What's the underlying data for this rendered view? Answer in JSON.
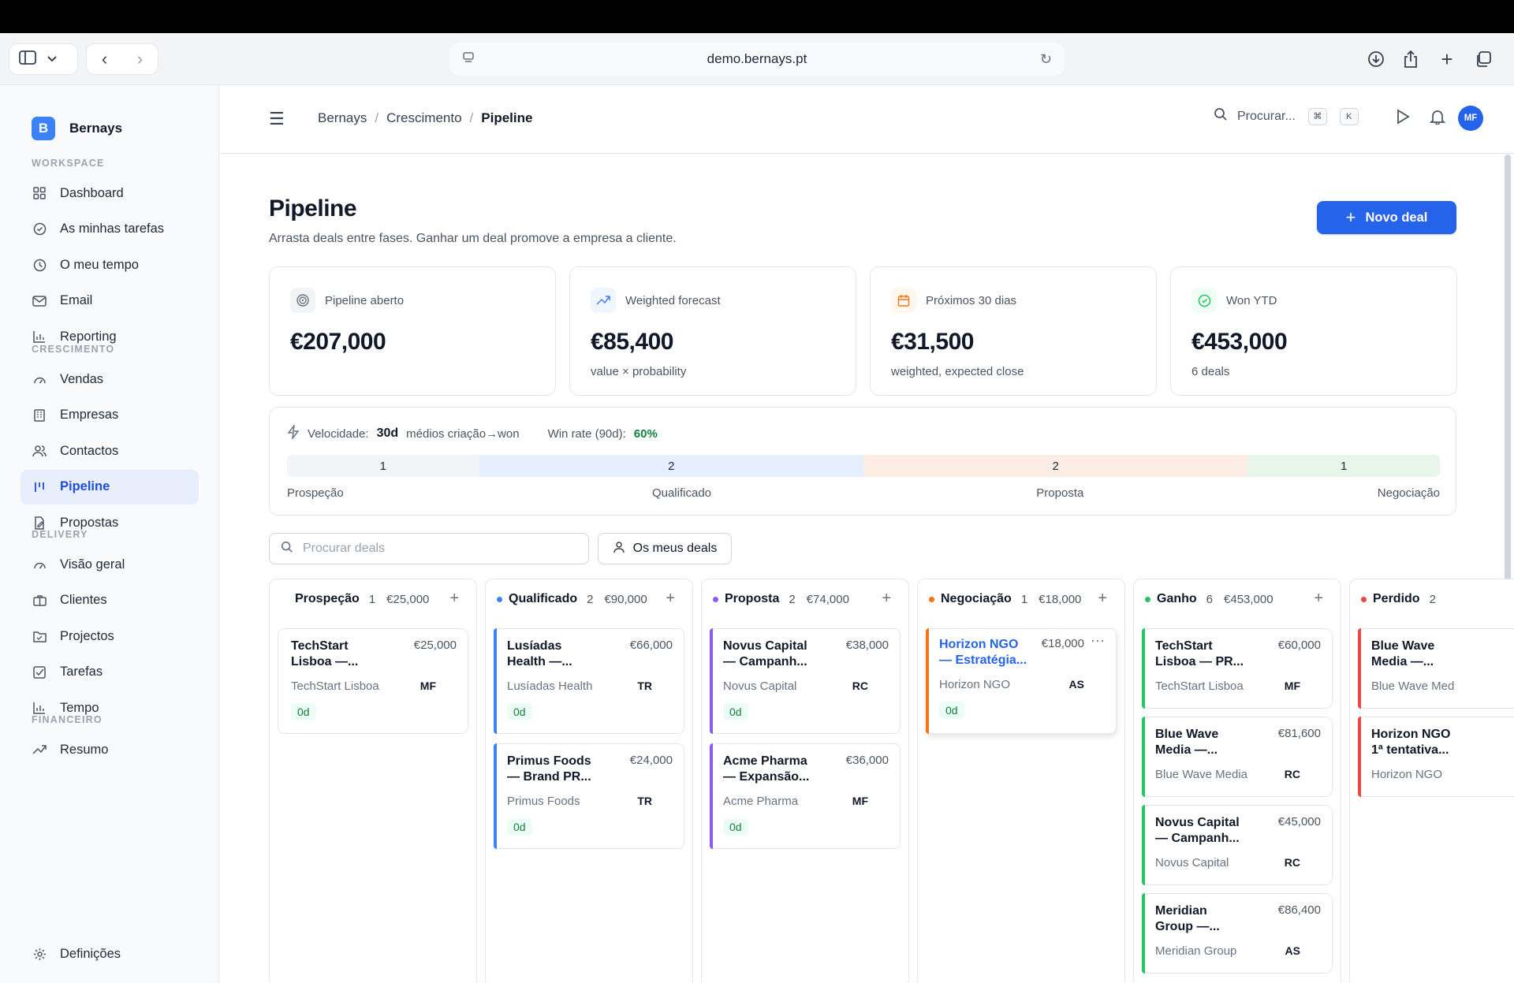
{
  "browser": {
    "url": "demo.bernays.pt"
  },
  "sidebar": {
    "brand": {
      "logo_letter": "B",
      "name": "Bernays"
    },
    "sections": [
      {
        "title": "WORKSPACE",
        "items": [
          {
            "label": "Dashboard",
            "icon": "grid-icon"
          },
          {
            "label": "As minhas tarefas",
            "icon": "check-circle-icon"
          },
          {
            "label": "O meu tempo",
            "icon": "clock-icon"
          },
          {
            "label": "Email",
            "icon": "mail-icon"
          },
          {
            "label": "Reporting",
            "icon": "bar-chart-icon"
          }
        ]
      },
      {
        "title": "CRESCIMENTO",
        "items": [
          {
            "label": "Vendas",
            "icon": "gauge-icon"
          },
          {
            "label": "Empresas",
            "icon": "building-icon"
          },
          {
            "label": "Contactos",
            "icon": "users-icon"
          },
          {
            "label": "Pipeline",
            "icon": "pipeline-icon",
            "active": true
          },
          {
            "label": "Propostas",
            "icon": "file-edit-icon"
          }
        ]
      },
      {
        "title": "DELIVERY",
        "items": [
          {
            "label": "Visão geral",
            "icon": "gauge-icon"
          },
          {
            "label": "Clientes",
            "icon": "briefcase-icon"
          },
          {
            "label": "Projectos",
            "icon": "folder-icon"
          },
          {
            "label": "Tarefas",
            "icon": "checkbox-icon"
          },
          {
            "label": "Tempo",
            "icon": "bar-chart-icon"
          }
        ]
      },
      {
        "title": "FINANCEIRO",
        "items": [
          {
            "label": "Resumo",
            "icon": "trend-up-icon"
          }
        ]
      }
    ],
    "settings_label": "Definições"
  },
  "header": {
    "breadcrumbs": [
      "Bernays",
      "Crescimento",
      "Pipeline"
    ],
    "search_label": "Procurar...",
    "kbd_1": "⌘",
    "kbd_2": "K",
    "avatar_initials": "MF"
  },
  "page": {
    "title": "Pipeline",
    "subtitle": "Arrasta deals entre fases. Ganhar um deal promove a empresa a cliente.",
    "new_deal_label": "Novo deal"
  },
  "kpis": [
    {
      "label": "Pipeline aberto",
      "value": "€207,000",
      "note": "",
      "icon": "target-icon",
      "color": "#6b7280",
      "bg": "#f3f4f6"
    },
    {
      "label": "Weighted forecast",
      "value": "€85,400",
      "note": "value × probability",
      "icon": "trend-up-icon",
      "color": "#3b82f6",
      "bg": "#eff6ff"
    },
    {
      "label": "Próximos 30 dias",
      "value": "€31,500",
      "note": "weighted, expected close",
      "icon": "calendar-icon",
      "color": "#f97316",
      "bg": "#fff7ed"
    },
    {
      "label": "Won YTD",
      "value": "€453,000",
      "note": "6 deals",
      "icon": "check-circle-icon",
      "color": "#22c55e",
      "bg": "#f0fdf4"
    }
  ],
  "velocity": {
    "label": "Velocidade:",
    "value": "30d",
    "desc": "médios criação→won",
    "winrate_label": "Win rate (90d):",
    "winrate_value": "60%",
    "stages": [
      {
        "label": "Prospeção",
        "count": "1",
        "color": "#f3f4f6"
      },
      {
        "label": "Qualificado",
        "count": "2",
        "color": "#e6efff"
      },
      {
        "label": "Proposta",
        "count": "2",
        "color": "#fbede4"
      },
      {
        "label": "Negociação",
        "count": "1",
        "color": "#e8f5e9"
      }
    ]
  },
  "filters": {
    "search_placeholder": "Procurar deals",
    "my_deals_label": "Os meus deals"
  },
  "columns": [
    {
      "name": "Prospeção",
      "count": "1",
      "total": "€25,000",
      "dot": "",
      "bar": "",
      "cards": [
        {
          "title": "TechStart Lisboa —...",
          "amount": "€25,000",
          "company": "TechStart Lisboa",
          "initials": "MF",
          "age": "0d"
        }
      ]
    },
    {
      "name": "Qualificado",
      "count": "2",
      "total": "€90,000",
      "dot": "#3b82f6",
      "bar": "#3b82f6",
      "cards": [
        {
          "title": "Lusíadas Health —...",
          "amount": "€66,000",
          "company": "Lusíadas Health",
          "initials": "TR",
          "age": "0d"
        },
        {
          "title": "Primus Foods — Brand PR...",
          "amount": "€24,000",
          "company": "Primus Foods",
          "initials": "TR",
          "age": "0d"
        }
      ]
    },
    {
      "name": "Proposta",
      "count": "2",
      "total": "€74,000",
      "dot": "#8b5cf6",
      "bar": "#8b5cf6",
      "cards": [
        {
          "title": "Novus Capital — Campanh...",
          "amount": "€38,000",
          "company": "Novus Capital",
          "initials": "RC",
          "age": "0d"
        },
        {
          "title": "Acme Pharma — Expansão...",
          "amount": "€36,000",
          "company": "Acme Pharma",
          "initials": "MF",
          "age": "0d"
        }
      ]
    },
    {
      "name": "Negociação",
      "count": "1",
      "total": "€18,000",
      "dot": "#f97316",
      "bar": "#f97316",
      "cards": [
        {
          "title": "Horizon NGO — Estratégia...",
          "amount": "€18,000",
          "company": "Horizon NGO",
          "initials": "AS",
          "age": "0d",
          "link": true,
          "more": "···"
        }
      ]
    },
    {
      "name": "Ganho",
      "count": "6",
      "total": "€453,000",
      "dot": "#22c55e",
      "bar": "#22c55e",
      "cards": [
        {
          "title": "TechStart Lisboa — PR...",
          "amount": "€60,000",
          "company": "TechStart Lisboa",
          "initials": "MF"
        },
        {
          "title": "Blue Wave Media —...",
          "amount": "€81,600",
          "company": "Blue Wave Media",
          "initials": "RC"
        },
        {
          "title": "Novus Capital — Campanh...",
          "amount": "€45,000",
          "company": "Novus Capital",
          "initials": "RC"
        },
        {
          "title": "Meridian Group —...",
          "amount": "€86,400",
          "company": "Meridian Group",
          "initials": "AS"
        }
      ]
    },
    {
      "name": "Perdido",
      "count": "2",
      "total": "",
      "dot": "#ef4444",
      "bar": "#ef4444",
      "cards": [
        {
          "title": "Blue Wave Media —...",
          "amount": "",
          "company": "Blue Wave Med",
          "initials": ""
        },
        {
          "title": "Horizon NGO 1ª tentativa...",
          "amount": "",
          "company": "Horizon NGO",
          "initials": ""
        }
      ]
    }
  ]
}
